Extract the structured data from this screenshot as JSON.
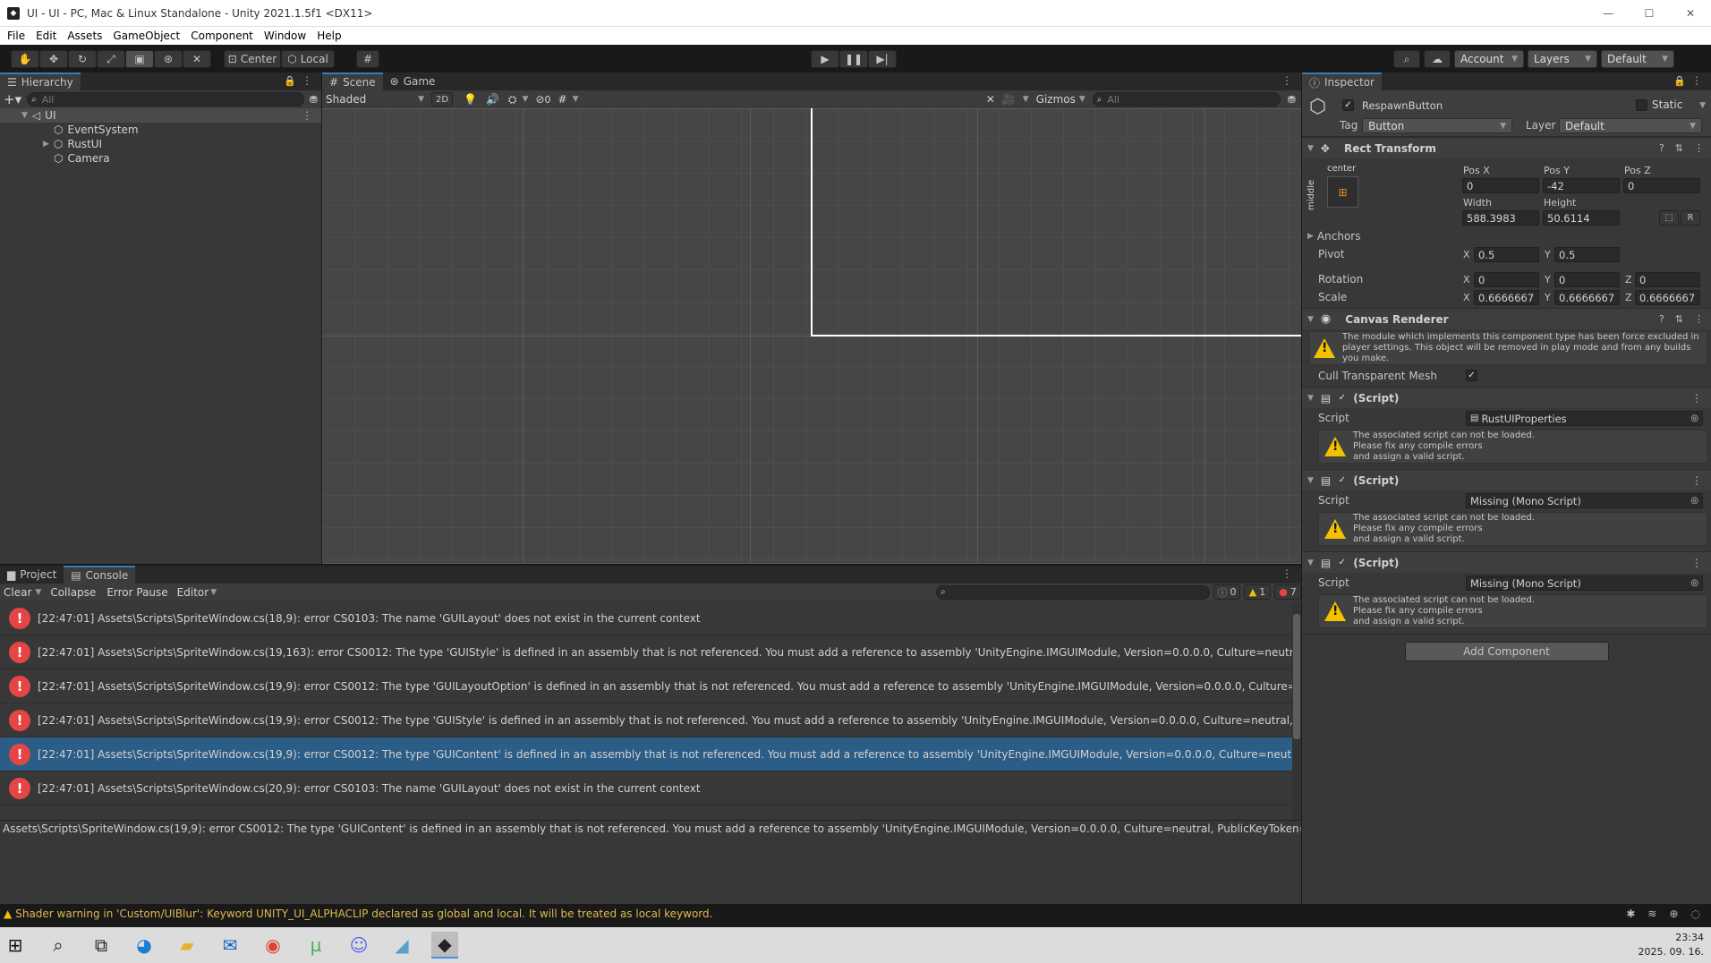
{
  "window": {
    "title": "UI - UI - PC, Mac & Linux Standalone - Unity 2021.1.5f1 <DX11>",
    "controls": [
      "—",
      "☐",
      "✕"
    ]
  },
  "menu": [
    "File",
    "Edit",
    "Assets",
    "GameObject",
    "Component",
    "Window",
    "Help"
  ],
  "toolbar": {
    "center_label": "Center",
    "local_label": "Local",
    "account_label": "Account",
    "layers_label": "Layers",
    "layout_label": "Default"
  },
  "hierarchy": {
    "tab": "Hierarchy",
    "search_placeholder": "All",
    "root": "UI",
    "items": [
      "EventSystem",
      "RustUI",
      "Camera"
    ]
  },
  "scene": {
    "tabs": [
      "Scene",
      "Game"
    ],
    "shading": "Shaded",
    "mode_2d": "2D",
    "hidden_count": "0",
    "gizmos": "Gizmos",
    "search_placeholder": "All"
  },
  "inspector": {
    "tab": "Inspector",
    "object_name": "RespawnButton",
    "static_label": "Static",
    "tag_label": "Tag",
    "tag_value": "Button",
    "layer_label": "Layer",
    "layer_value": "Default",
    "rect_transform": {
      "title": "Rect Transform",
      "anchor_h": "center",
      "anchor_v": "middle",
      "pos_x_label": "Pos X",
      "pos_x": "0",
      "pos_y_label": "Pos Y",
      "pos_y": "-42",
      "pos_z_label": "Pos Z",
      "pos_z": "0",
      "width_label": "Width",
      "width": "588.3983",
      "height_label": "Height",
      "height": "50.6114",
      "r_button": "R",
      "anchors_label": "Anchors",
      "pivot_label": "Pivot",
      "pivot_x": "0.5",
      "pivot_y": "0.5",
      "rotation_label": "Rotation",
      "rot_x": "0",
      "rot_y": "0",
      "rot_z": "0",
      "scale_label": "Scale",
      "scale_x": "0.6666667",
      "scale_y": "0.6666667",
      "scale_z": "0.6666667",
      "x": "X",
      "y": "Y",
      "z": "Z"
    },
    "canvas_renderer": {
      "title": "Canvas Renderer",
      "warning": "The module which implements this component type has been force excluded in player settings. This object will be removed in play mode and from any builds you make.",
      "cull_label": "Cull Transparent Mesh"
    },
    "scripts": [
      {
        "title": "(Script)",
        "script_label": "Script",
        "value": "RustUIProperties",
        "warning": [
          "The associated script can not be loaded.",
          "Please fix any compile errors",
          "and assign a valid script."
        ]
      },
      {
        "title": "(Script)",
        "script_label": "Script",
        "value": "Missing (Mono Script)",
        "warning": [
          "The associated script can not be loaded.",
          "Please fix any compile errors",
          "and assign a valid script."
        ]
      },
      {
        "title": "(Script)",
        "script_label": "Script",
        "value": "Missing (Mono Script)",
        "warning": [
          "The associated script can not be loaded.",
          "Please fix any compile errors",
          "and assign a valid script."
        ]
      }
    ],
    "add_component": "Add Component"
  },
  "console": {
    "tabs": [
      "Project",
      "Console"
    ],
    "clear": "Clear",
    "collapse": "Collapse",
    "error_pause": "Error Pause",
    "editor": "Editor",
    "count_info": "0",
    "count_warn": "1",
    "count_err": "7",
    "rows": [
      "[22:47:01] Assets\\Scripts\\SpriteWindow.cs(18,9): error CS0103: The name 'GUILayout' does not exist in the current context",
      "[22:47:01] Assets\\Scripts\\SpriteWindow.cs(19,163): error CS0012: The type 'GUIStyle' is defined in an assembly that is not referenced. You must add a reference to assembly 'UnityEngine.IMGUIModule, Version=0.0.0.0, Culture=neutral, PublicKeyToke",
      "[22:47:01] Assets\\Scripts\\SpriteWindow.cs(19,9): error CS0012: The type 'GUILayoutOption' is defined in an assembly that is not referenced. You must add a reference to assembly 'UnityEngine.IMGUIModule, Version=0.0.0.0, Culture=neutral, PublicKey",
      "[22:47:01] Assets\\Scripts\\SpriteWindow.cs(19,9): error CS0012: The type 'GUIStyle' is defined in an assembly that is not referenced. You must add a reference to assembly 'UnityEngine.IMGUIModule, Version=0.0.0.0, Culture=neutral, PublicKeyToken=",
      "[22:47:01] Assets\\Scripts\\SpriteWindow.cs(19,9): error CS0012: The type 'GUIContent' is defined in an assembly that is not referenced. You must add a reference to assembly 'UnityEngine.IMGUIModule, Version=0.0.0.0, Culture=neutral, PublicKeyToke",
      "[22:47:01] Assets\\Scripts\\SpriteWindow.cs(20,9): error CS0103: The name 'GUILayout' does not exist in the current context"
    ],
    "selected_row": 4,
    "detail": "Assets\\Scripts\\SpriteWindow.cs(19,9): error CS0012: The type 'GUIContent' is defined in an assembly that is not referenced. You must add a reference to assembly 'UnityEngine.IMGUIModule, Version=0.0.0.0, Culture=neutral, PublicKeyToken=null'."
  },
  "status_bar": {
    "message": "Shader warning in 'Custom/UIBlur': Keyword UNITY_UI_ALPHACLIP declared as global and local. It will be treated as local keyword."
  },
  "taskbar": {
    "time": "23:34",
    "date": "2025. 09. 16."
  }
}
